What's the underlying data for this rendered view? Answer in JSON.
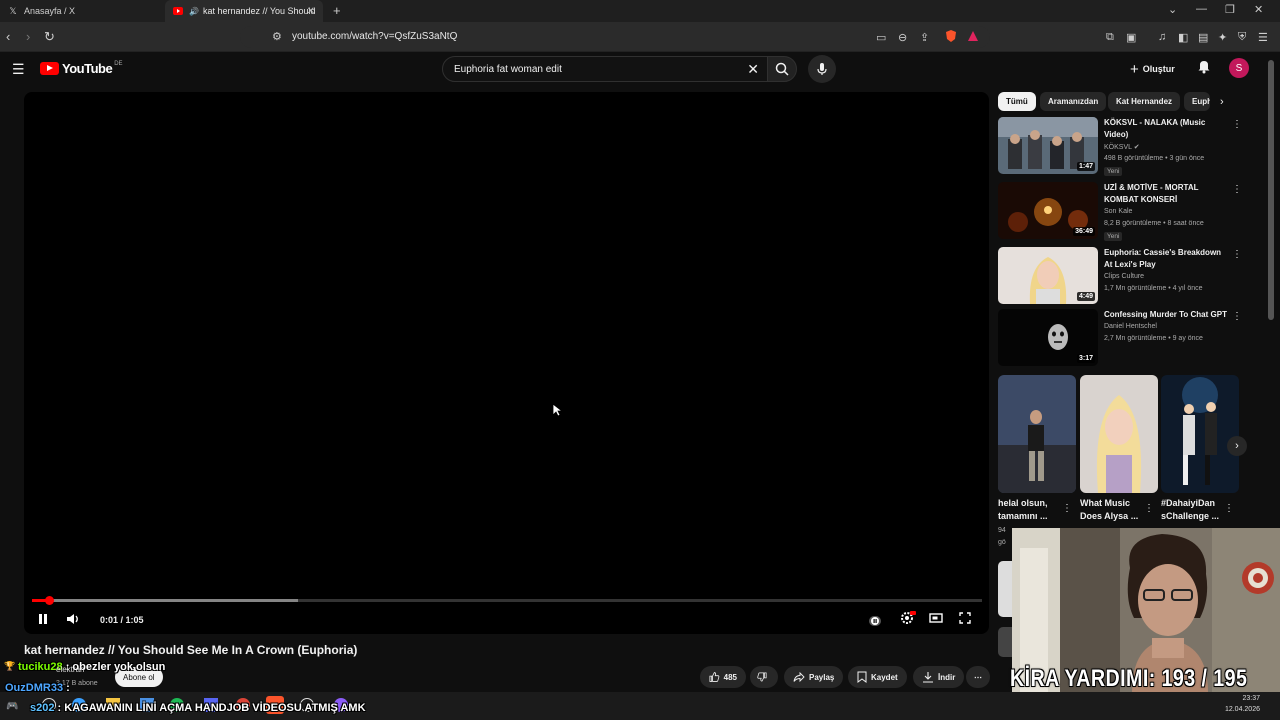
{
  "browser": {
    "tabs": [
      {
        "title": "Anasayfa / X",
        "favicon": "x-icon",
        "active": false
      },
      {
        "title": "kat hernandez // You Should",
        "favicon": "youtube-icon",
        "active": true
      }
    ],
    "url": "youtube.com/watch?v=QsfZuS3aNtQ"
  },
  "youtube": {
    "logo_text": "YouTube",
    "region": "DE",
    "search_query": "Euphoria fat woman edit",
    "create_label": "Oluştur",
    "avatar_letter": "S"
  },
  "player": {
    "current_time": "0:01",
    "duration": "1:05",
    "time_display": "0:01 / 1:05",
    "played_fraction": 0.018,
    "buffered_fraction": 0.28
  },
  "video": {
    "title": "kat hernandez // You Should See Me In A Crown (Euphoria)",
    "subscribe_label": "Abone ol",
    "likes": "485",
    "share_label": "Paylaş",
    "save_label": "Kaydet",
    "download_label": "İndir"
  },
  "sidebar": {
    "chips": [
      "Tümü",
      "Aramanızdan",
      "Kat Hernandez",
      "Euph"
    ],
    "recommendations": [
      {
        "title_line1": "KÖKSVL - NALAKA (Music",
        "title_line2": "Video)",
        "channel": "KÖKSVL",
        "verified": true,
        "meta": "498 B görüntüleme • 3 gün önce",
        "badge": "Yeni",
        "duration": "1:47"
      },
      {
        "title_line1": "UZİ & MOTİVE - MORTAL",
        "title_line2": "KOMBAT KONSERİ",
        "channel": "Son Kale",
        "verified": false,
        "meta": "8,2 B görüntüleme • 8 saat önce",
        "badge": "Yeni",
        "duration": "36:49"
      },
      {
        "title_line1": "Euphoria: Cassie's Breakdown",
        "title_line2": "At Lexi's Play",
        "channel": "Clips Culture",
        "verified": false,
        "meta": "1,7 Mn görüntüleme • 4 yıl önce",
        "badge": "",
        "duration": "4:49"
      },
      {
        "title_line1": "Confessing Murder To Chat GPT",
        "title_line2": "",
        "channel": "Daniel Hentschel",
        "verified": false,
        "meta": "2,7 Mn görüntüleme • 9 ay önce",
        "badge": "",
        "duration": "3:17"
      }
    ],
    "shorts": [
      {
        "title_line1": "helal olsun,",
        "title_line2": "tamamını ..."
      },
      {
        "title_line1": "What Music",
        "title_line2": "Does Alysa ..."
      },
      {
        "title_line1": "#DahaiyiDan",
        "title_line2": "sChallenge ..."
      }
    ],
    "partial_meta_1": "94",
    "partial_meta_2": "gö"
  },
  "stream": {
    "caption": "KİRA YARDIMI:  193 / 195",
    "chat": [
      {
        "user": "tuciku28",
        "message": ": obezler yok olsun",
        "color": "#7cfc00"
      },
      {
        "user": "OuzDMR33",
        "message": ":",
        "color": "#4da6ff"
      },
      {
        "user": "s202",
        "message": ": KAGAWANIN LİNİ AÇMA HANDJOB VİDEOSU ATMIŞ AMK",
        "color": "#5dc1ff"
      }
    ],
    "under_caption": "elektran",
    "under_meta": "3,17 B abone"
  },
  "taskbar": {
    "time": "23:37",
    "date": "12.04.2026"
  },
  "colors": {
    "youtube_red": "#ff0000",
    "page_bg": "#0f0f0f",
    "avatar": "#c2185b"
  }
}
